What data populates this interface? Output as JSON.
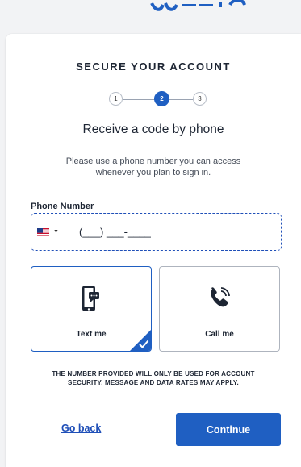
{
  "page": {
    "title": "SECURE YOUR ACCOUNT",
    "subtitle": "Receive a code by phone",
    "description": "Please use a phone number you can access whenever you plan to sign in."
  },
  "stepper": {
    "steps": [
      "1",
      "2",
      "3"
    ],
    "active_step": "2"
  },
  "phone": {
    "label": "Phone Number",
    "placeholder": "(___) ___-____",
    "value": "",
    "country_flag_icon": "us-flag-icon"
  },
  "methods": [
    {
      "label": "Text me",
      "icon": "mobile-message-icon",
      "selected": true
    },
    {
      "label": "Call me",
      "icon": "phone-call-icon",
      "selected": false
    }
  ],
  "disclaimer": "THE NUMBER PROVIDED WILL ONLY BE USED FOR ACCOUNT SECURITY. MESSAGE AND DATA RATES MAY APPLY.",
  "actions": {
    "back_label": "Go back",
    "continue_label": "Continue"
  },
  "colors": {
    "accent": "#1f5fc2",
    "text": "#1d2533",
    "border": "#aeb4be",
    "background": "#f2f3f5"
  }
}
